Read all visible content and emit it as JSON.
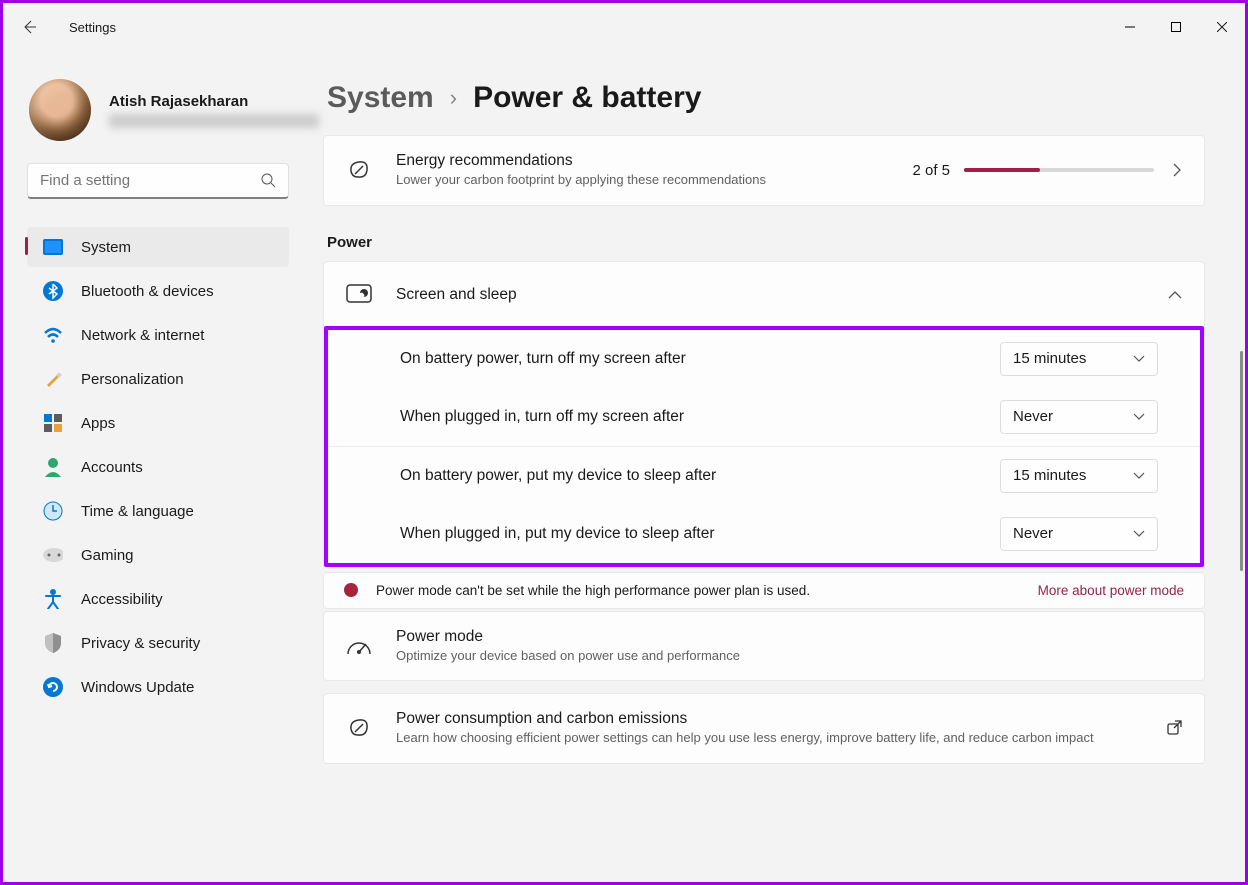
{
  "window": {
    "title": "Settings"
  },
  "profile": {
    "name": "Atish Rajasekharan"
  },
  "search": {
    "placeholder": "Find a setting"
  },
  "nav": {
    "items": [
      {
        "label": "System"
      },
      {
        "label": "Bluetooth & devices"
      },
      {
        "label": "Network & internet"
      },
      {
        "label": "Personalization"
      },
      {
        "label": "Apps"
      },
      {
        "label": "Accounts"
      },
      {
        "label": "Time & language"
      },
      {
        "label": "Gaming"
      },
      {
        "label": "Accessibility"
      },
      {
        "label": "Privacy & security"
      },
      {
        "label": "Windows Update"
      }
    ]
  },
  "breadcrumb": {
    "parent": "System",
    "current": "Power & battery"
  },
  "energy": {
    "title": "Energy recommendations",
    "sub": "Lower your carbon footprint by applying these recommendations",
    "count": "2 of 5",
    "progress_pct": 40
  },
  "section_power": "Power",
  "screen_sleep": {
    "title": "Screen and sleep",
    "rows": [
      {
        "label": "On battery power, turn off my screen after",
        "value": "15 minutes"
      },
      {
        "label": "When plugged in, turn off my screen after",
        "value": "Never"
      },
      {
        "label": "On battery power, put my device to sleep after",
        "value": "15 minutes"
      },
      {
        "label": "When plugged in, put my device to sleep after",
        "value": "Never"
      }
    ]
  },
  "info": {
    "text": "Power mode can't be set while the high performance power plan is used.",
    "link": "More about power mode"
  },
  "power_mode": {
    "title": "Power mode",
    "sub": "Optimize your device based on power use and performance"
  },
  "carbon": {
    "title": "Power consumption and carbon emissions",
    "sub": "Learn how choosing efficient power settings can help you use less energy, improve battery life, and reduce carbon impact"
  }
}
